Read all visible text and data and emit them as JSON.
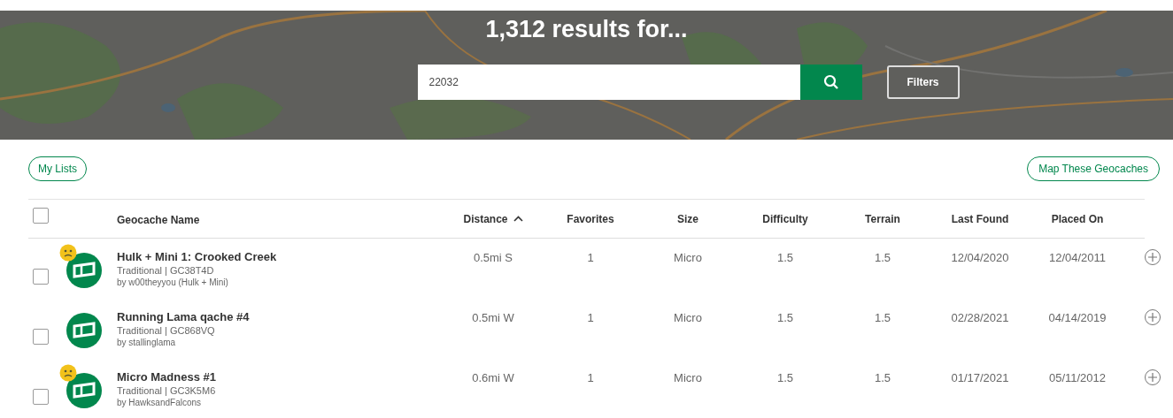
{
  "hero": {
    "title": "1,312 results for...",
    "search": {
      "value": "22032"
    },
    "filters_button": "Filters"
  },
  "actions": {
    "left": "My Lists",
    "right": "Map These Geocaches"
  },
  "table": {
    "select_all": {
      "checked": false
    },
    "columns": [
      {
        "label": "Geocache Name",
        "sorted": false
      },
      {
        "label": "Distance",
        "sorted": true
      },
      {
        "label": "Favorites",
        "sorted": false
      },
      {
        "label": "Size",
        "sorted": false
      },
      {
        "label": "Difficulty",
        "sorted": false
      },
      {
        "label": "Terrain",
        "sorted": false
      },
      {
        "label": "Last Found",
        "sorted": false
      },
      {
        "label": "Placed On",
        "sorted": false
      }
    ],
    "rows": [
      {
        "checked": false,
        "flagged": true,
        "name": "Hulk + Mini 1: Crooked Creek",
        "type_code": "Traditional | GC38T4D",
        "owner": "by w00theyyou (Hulk + Mini)",
        "distance": "0.5mi S",
        "favorites": "1",
        "size": "Micro",
        "difficulty": "1.5",
        "terrain": "1.5",
        "last_found": "12/04/2020",
        "placed_on": "12/04/2011"
      },
      {
        "checked": false,
        "flagged": false,
        "name": "Running Lama qache #4",
        "type_code": "Traditional | GC868VQ",
        "owner": "by stallinglama",
        "distance": "0.5mi W",
        "favorites": "1",
        "size": "Micro",
        "difficulty": "1.5",
        "terrain": "1.5",
        "last_found": "02/28/2021",
        "placed_on": "04/14/2019"
      },
      {
        "checked": false,
        "flagged": true,
        "name": "Micro Madness #1",
        "type_code": "Traditional | GC3K5M6",
        "owner": "by HawksandFalcons",
        "distance": "0.6mi W",
        "favorites": "1",
        "size": "Micro",
        "difficulty": "1.5",
        "terrain": "1.5",
        "last_found": "01/17/2021",
        "placed_on": "05/11/2012"
      }
    ]
  }
}
